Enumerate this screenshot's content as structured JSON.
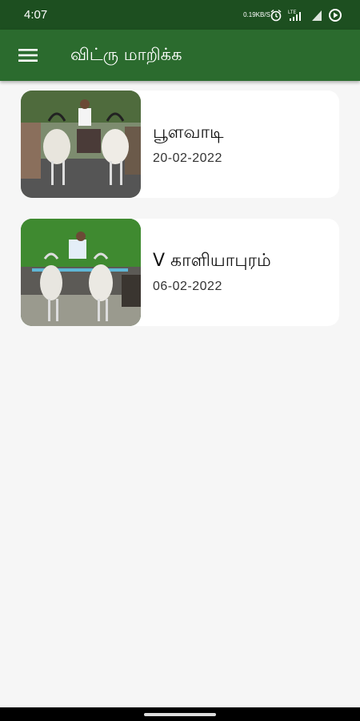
{
  "status": {
    "time": "4:07",
    "net_speed_top": "0.19",
    "net_speed_bottom": "KB/S",
    "network_type": "LTE"
  },
  "appbar": {
    "title": "விட்ரு மாறிக்க",
    "menu_icon": "hamburger-menu-icon",
    "color": "#2b6b2e"
  },
  "events": [
    {
      "title": "பூளவாடி",
      "date": "20-02-2022"
    },
    {
      "title": "V காளியாபுரம்",
      "date": "06-02-2022"
    }
  ],
  "colors": {
    "statusbar": "#1d4f20",
    "background": "#f6f6f6",
    "card": "#ffffff"
  }
}
